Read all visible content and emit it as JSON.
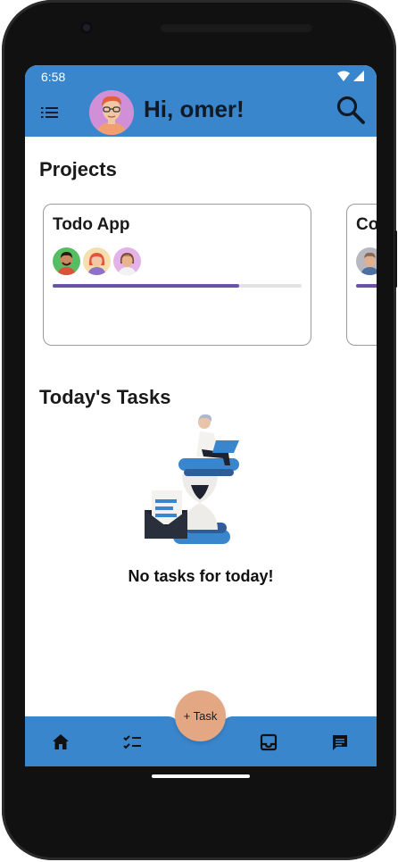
{
  "status_bar": {
    "time": "6:58",
    "icons": [
      "wifi-icon",
      "signal-icon"
    ]
  },
  "app_bar": {
    "greeting": "Hi, omer!",
    "menu_icon": "menu-icon",
    "search_icon": "search-icon"
  },
  "projects": {
    "title": "Projects",
    "items": [
      {
        "name": "Todo App",
        "members": 3,
        "progress": 0.75
      },
      {
        "name": "Co",
        "members": 1,
        "progress": 0.5
      }
    ]
  },
  "todays_tasks": {
    "title": "Today's Tasks",
    "empty_message": "No tasks for today!"
  },
  "fab": {
    "label": "+ Task"
  },
  "bottom_nav": {
    "items": [
      "home-icon",
      "tasks-checklist-icon",
      "inbox-icon",
      "chat-icon"
    ]
  },
  "colors": {
    "primary": "#3a86cc",
    "accent": "#e3a883",
    "progress": "#6b52a8"
  }
}
